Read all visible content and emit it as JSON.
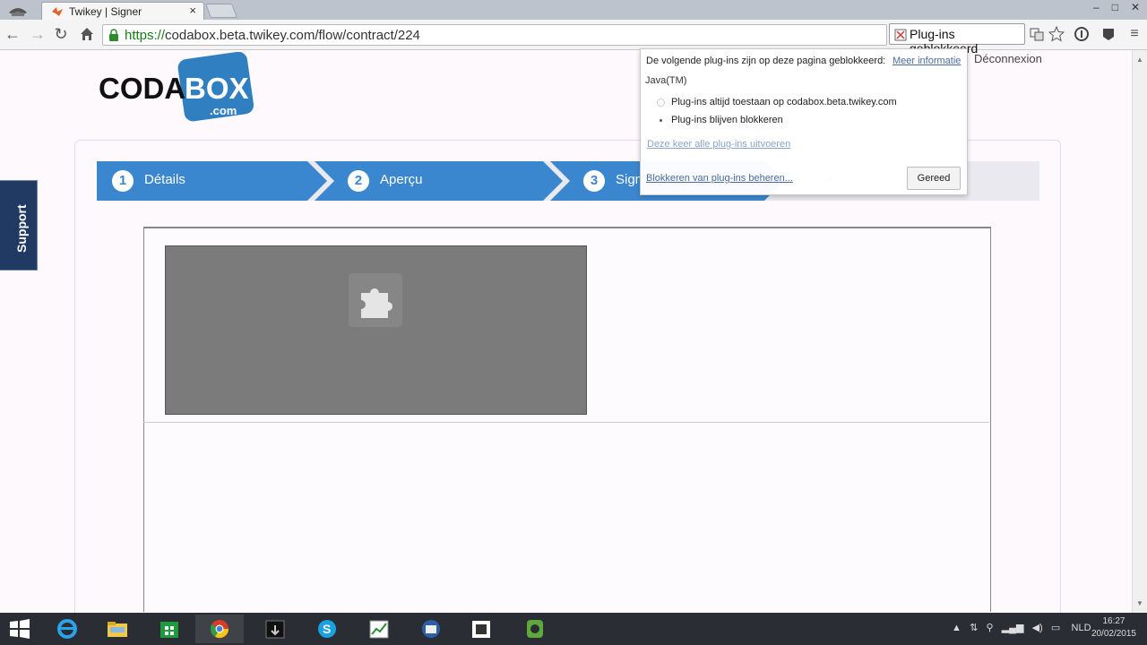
{
  "browser": {
    "tab_title": "Twikey | Signer",
    "tab_close": "×",
    "url_scheme": "https://",
    "url_rest": "codabox.beta.twikey.com/flow/contract/224",
    "plugin_badge": "Plug-ins geblokkeerd"
  },
  "page": {
    "logo_top": "CODA",
    "logo_box": "BOX",
    "logo_com": ".com",
    "logout": "Déconnexion",
    "support": "Support",
    "steps": [
      {
        "num": "1",
        "label": "Détails"
      },
      {
        "num": "2",
        "label": "Aperçu"
      },
      {
        "num": "3",
        "label": "Signer"
      },
      {
        "num": "4",
        "label": ""
      }
    ]
  },
  "popup": {
    "header": "De volgende plug-ins zijn op deze pagina geblokkeerd:",
    "more_info": "Meer informatie",
    "plugin_name": "Java(TM)",
    "option_allow": "Plug-ins altijd toestaan op codabox.beta.twikey.com",
    "option_block": "Plug-ins blijven blokkeren",
    "run_once": "Deze keer alle plug-ins uitvoeren",
    "manage": "Blokkeren van plug-ins beheren...",
    "done": "Gereed"
  },
  "taskbar": {
    "lang": "NLD",
    "time": "16:27",
    "date": "20/02/2015"
  },
  "colors": {
    "step_blue": "#3b87cf",
    "support_navy": "#203a64",
    "logo_blue": "#2f7fc1"
  }
}
